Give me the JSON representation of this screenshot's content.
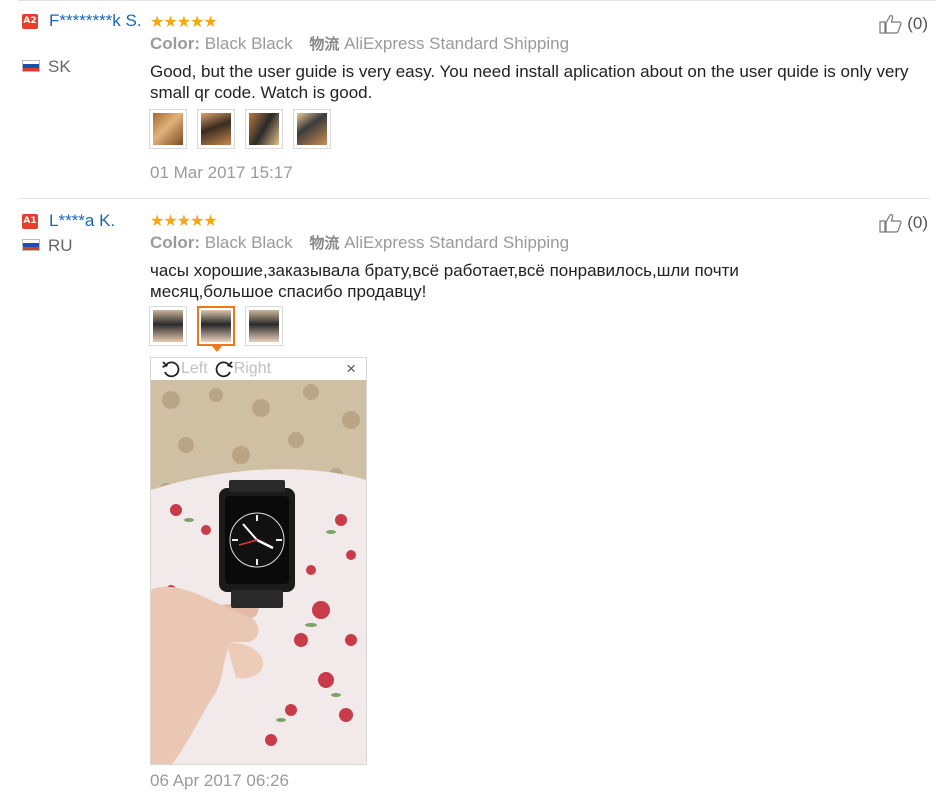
{
  "reviews": [
    {
      "badge": "A2",
      "user": "F********k S.",
      "country": "SK",
      "stars": "★★★★★",
      "color_key": "Color:",
      "color_value": "Black Black",
      "shipping_key": "物流",
      "shipping_value": "AliExpress Standard Shipping",
      "text": "Good, but the user guide is very easy. You need install aplication about on the user quide is only very small qr code. Watch is good.",
      "date": "01 Mar 2017 15:17",
      "helpful": "(0)",
      "thumbnail_count": 4
    },
    {
      "badge": "A1",
      "user": "L****a K.",
      "country": "RU",
      "stars": "★★★★★",
      "color_key": "Color:",
      "color_value": "Black Black",
      "shipping_key": "物流",
      "shipping_value": "AliExpress Standard Shipping",
      "text": "часы хорошие,заказывала брату,всё работает,всё понравилось,шли почти месяц,большое спасибо продавцу!",
      "date": "06 Apr 2017 06:26",
      "helpful": "(0)",
      "thumbnail_count": 3,
      "active_thumbnail": 2
    }
  ],
  "viewer": {
    "rotate_left": "Left",
    "rotate_right": "Right",
    "close": "×"
  },
  "colors": {
    "link": "#1a66b5",
    "star": "#f5a70e",
    "badge": "#e2402a",
    "active_thumb": "#f07818",
    "muted": "#9a9a9a"
  },
  "icons": [
    "thumbs-up-icon",
    "rotate-left-icon",
    "rotate-right-icon",
    "close-icon",
    "flag-slovakia-icon",
    "flag-russia-icon"
  ]
}
